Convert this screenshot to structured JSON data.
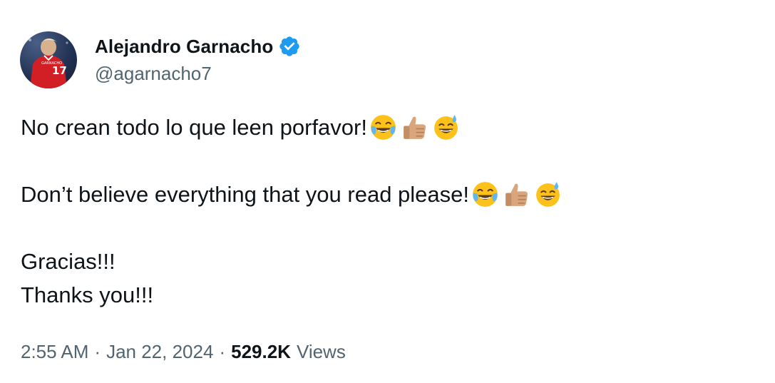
{
  "author": {
    "display_name": "Alejandro Garnacho",
    "handle": "@agarnacho7",
    "verified": true,
    "verified_color": "#1d9bf0",
    "avatar_icon": "profile-photo-red-jersey-17"
  },
  "tweet": {
    "lines": [
      {
        "text": "No crean todo lo que leen porfavor!",
        "emojis": [
          "face-with-tears-of-joy-icon",
          "thumbs-up-medium-light-icon",
          "grinning-sweat-icon"
        ]
      },
      {
        "text": "Don’t believe everything that you read please!",
        "emojis": [
          "face-with-tears-of-joy-icon",
          "thumbs-up-medium-light-icon",
          "grinning-sweat-icon"
        ]
      },
      {
        "text": "Gracias!!!"
      },
      {
        "text": "Thanks you!!!"
      }
    ]
  },
  "meta": {
    "time": "2:55 AM",
    "separator": "·",
    "date": "Jan 22, 2024",
    "views_count": "529.2K",
    "views_label": "Views"
  },
  "colors": {
    "text_primary": "#0f1419",
    "text_secondary": "#536471",
    "emoji_yellow": "#fcc21b",
    "emoji_skin": "#d9a57c"
  }
}
